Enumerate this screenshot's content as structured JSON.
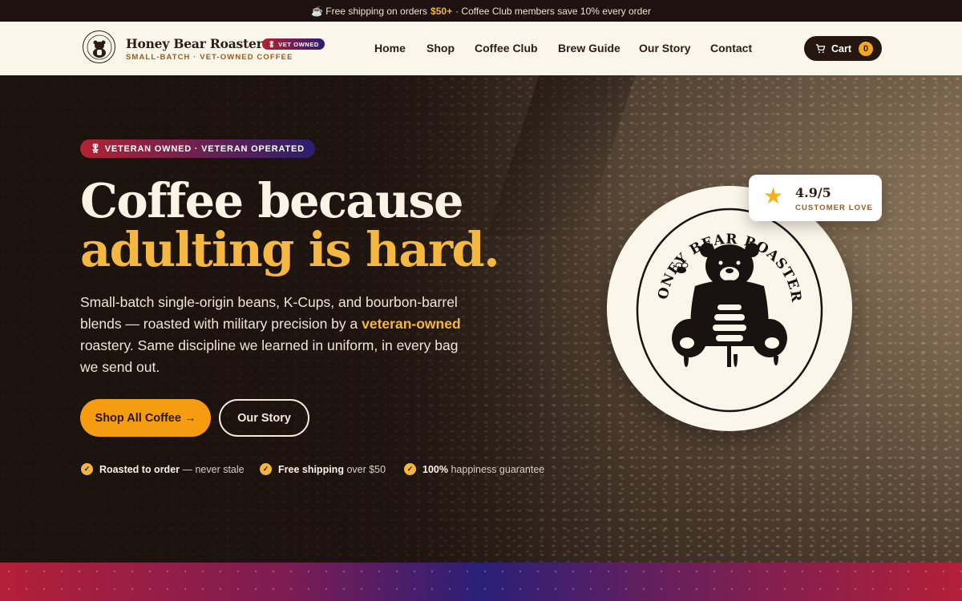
{
  "announcement": {
    "icon": "coffee-cup-icon",
    "prefix": "☕ Free shipping on orders",
    "highlight": "$50+",
    "suffix": "· Coffee Club members save 10% every order"
  },
  "header": {
    "brand_name": "Honey Bear Roasters",
    "vet_badge": "VET OWNED",
    "tagline": "SMALL-BATCH · VET-OWNED COFFEE",
    "nav": [
      {
        "label": "Home"
      },
      {
        "label": "Shop"
      },
      {
        "label": "Coffee Club"
      },
      {
        "label": "Brew Guide"
      },
      {
        "label": "Our Story"
      },
      {
        "label": "Contact"
      }
    ],
    "cart": {
      "label": "Cart",
      "count": "0"
    }
  },
  "hero": {
    "pill": "VETERAN OWNED · VETERAN OPERATED",
    "headline_line1": "Coffee because",
    "headline_line2": "adulting is hard.",
    "lead_part1": "Small-batch single-origin beans, K-Cups, and bourbon-barrel blends — roasted with military precision by a",
    "lead_highlight": "veteran-owned",
    "lead_part2": "roastery. Same discipline we learned in uniform, in every bag we send out.",
    "primary_cta": "Shop All Coffee →",
    "secondary_cta": "Our Story",
    "trust": [
      {
        "bold": "Roasted to order",
        "rest": "— never stale"
      },
      {
        "bold": "Free shipping",
        "rest": "over $50"
      },
      {
        "bold": "100%",
        "rest": "happiness guarantee"
      }
    ],
    "emblem_text": "HONEY BEAR ROASTERS",
    "rating": {
      "value": "4.9/5",
      "label": "CUSTOMER LOVE"
    }
  },
  "colors": {
    "accent": "#f5a623",
    "headline_gold": "#f4b840",
    "dark": "#1d1210",
    "cream": "#fbf6ea",
    "flag_red": "#b22234",
    "flag_blue": "#2b1f6e"
  }
}
